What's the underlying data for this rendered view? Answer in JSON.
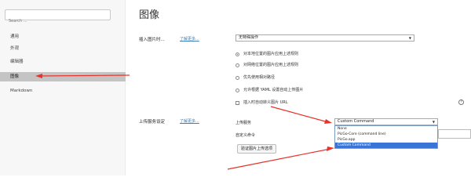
{
  "sidebar": {
    "search_placeholder": "Search ...",
    "items": [
      {
        "label": "通用"
      },
      {
        "label": "外观"
      },
      {
        "label": "编辑器"
      },
      {
        "label": "图像"
      },
      {
        "label": "Markdown"
      }
    ]
  },
  "main": {
    "title": "图像",
    "insert": {
      "label": "插入图片时...",
      "link": "了解更多...",
      "select_value": "无特殊操作",
      "options": [
        {
          "label": "对本地位置的图片应用上述规则",
          "type": "radio"
        },
        {
          "label": "对网络位置的图片应用上述规则",
          "type": "radio"
        },
        {
          "label": "优先使用相对路径",
          "type": "radio"
        },
        {
          "label": "允许根据 YAML 设置自动上传图片",
          "type": "radio"
        },
        {
          "label": "插入时自动转义图片 URL",
          "type": "checkbox"
        }
      ]
    },
    "upload": {
      "label": "上传服务设定",
      "link": "了解更多...",
      "service_label": "上传服务",
      "service_value": "Custom Command",
      "command_label": "自定义命令",
      "test_button": "验证图片上传选项",
      "dropdown_options": [
        "None",
        "PicGo-Core (command line)",
        "PicGo.app",
        "Custom Command"
      ],
      "selected_option": "Custom Command"
    }
  },
  "colors": {
    "arrow": "#e8322b",
    "link": "#3c7fb6",
    "highlight": "#3875d7"
  }
}
